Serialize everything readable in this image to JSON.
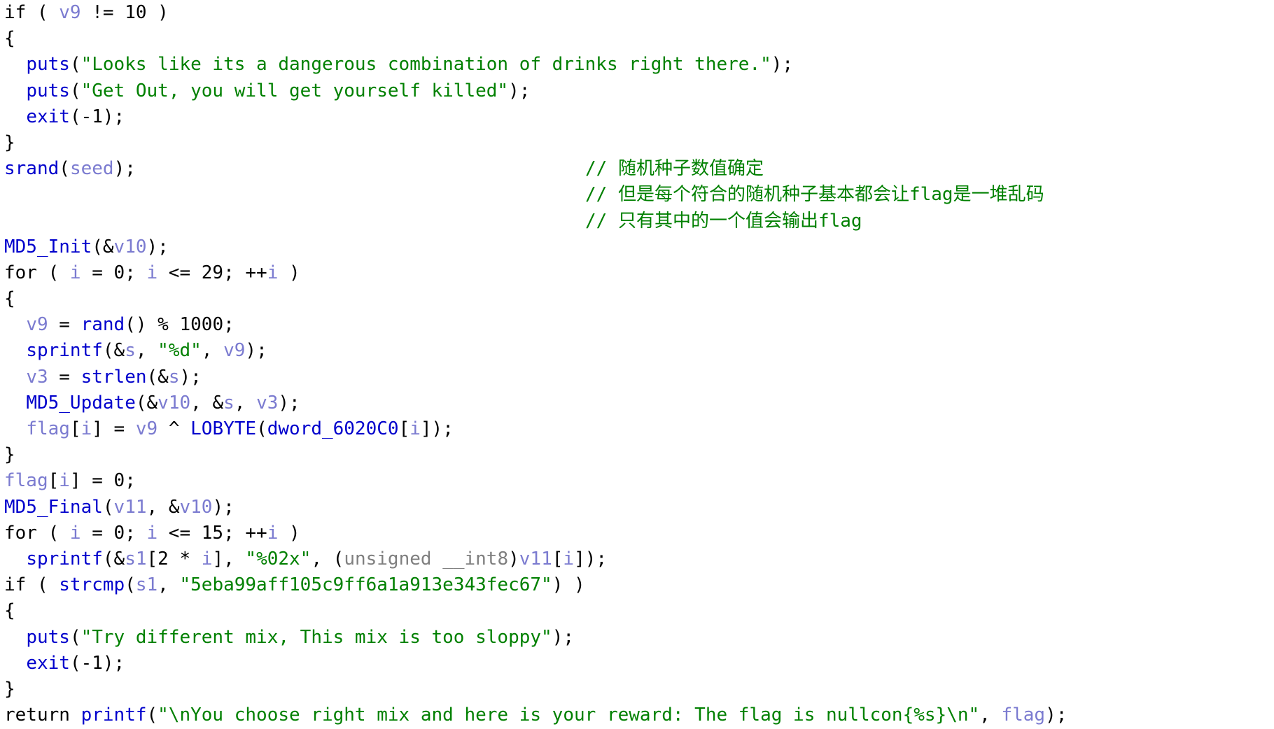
{
  "code": {
    "lines": [
      [
        [
          "kw",
          "if ( "
        ],
        [
          "var",
          "v9"
        ],
        [
          "punc",
          " != 10 )"
        ]
      ],
      [
        [
          "punc",
          "{"
        ]
      ],
      [
        [
          "punc",
          "  "
        ],
        [
          "fn",
          "puts"
        ],
        [
          "punc",
          "("
        ],
        [
          "str",
          "\"Looks like its a dangerous combination of drinks right there.\""
        ],
        [
          "punc",
          ");"
        ]
      ],
      [
        [
          "punc",
          "  "
        ],
        [
          "fn",
          "puts"
        ],
        [
          "punc",
          "("
        ],
        [
          "str",
          "\"Get Out, you will get yourself killed\""
        ],
        [
          "punc",
          ");"
        ]
      ],
      [
        [
          "punc",
          "  "
        ],
        [
          "fn",
          "exit"
        ],
        [
          "punc",
          "(-1);"
        ]
      ],
      [
        [
          "punc",
          "}"
        ]
      ],
      [
        [
          "fn",
          "srand"
        ],
        [
          "punc",
          "("
        ],
        [
          "var",
          "seed"
        ],
        [
          "punc",
          ");"
        ]
      ],
      [],
      [],
      [
        [
          "fn",
          "MD5_Init"
        ],
        [
          "punc",
          "(&"
        ],
        [
          "var",
          "v10"
        ],
        [
          "punc",
          ");"
        ]
      ],
      [
        [
          "kw",
          "for ( "
        ],
        [
          "var",
          "i"
        ],
        [
          "punc",
          " = 0; "
        ],
        [
          "var",
          "i"
        ],
        [
          "punc",
          " <= 29; ++"
        ],
        [
          "var",
          "i"
        ],
        [
          "punc",
          " )"
        ]
      ],
      [
        [
          "punc",
          "{"
        ]
      ],
      [
        [
          "punc",
          "  "
        ],
        [
          "var",
          "v9"
        ],
        [
          "punc",
          " = "
        ],
        [
          "fn",
          "rand"
        ],
        [
          "punc",
          "() % 1000;"
        ]
      ],
      [
        [
          "punc",
          "  "
        ],
        [
          "fn",
          "sprintf"
        ],
        [
          "punc",
          "(&"
        ],
        [
          "var",
          "s"
        ],
        [
          "punc",
          ", "
        ],
        [
          "str",
          "\"%d\""
        ],
        [
          "punc",
          ", "
        ],
        [
          "var",
          "v9"
        ],
        [
          "punc",
          ");"
        ]
      ],
      [
        [
          "punc",
          "  "
        ],
        [
          "var",
          "v3"
        ],
        [
          "punc",
          " = "
        ],
        [
          "fn",
          "strlen"
        ],
        [
          "punc",
          "(&"
        ],
        [
          "var",
          "s"
        ],
        [
          "punc",
          ");"
        ]
      ],
      [
        [
          "punc",
          "  "
        ],
        [
          "fn",
          "MD5_Update"
        ],
        [
          "punc",
          "(&"
        ],
        [
          "var",
          "v10"
        ],
        [
          "punc",
          ", &"
        ],
        [
          "var",
          "s"
        ],
        [
          "punc",
          ", "
        ],
        [
          "var",
          "v3"
        ],
        [
          "punc",
          ");"
        ]
      ],
      [
        [
          "punc",
          "  "
        ],
        [
          "var",
          "flag"
        ],
        [
          "punc",
          "["
        ],
        [
          "var",
          "i"
        ],
        [
          "punc",
          "] = "
        ],
        [
          "var",
          "v9"
        ],
        [
          "punc",
          " ^ "
        ],
        [
          "fn",
          "LOBYTE"
        ],
        [
          "punc",
          "("
        ],
        [
          "fn",
          "dword_6020C0"
        ],
        [
          "punc",
          "["
        ],
        [
          "var",
          "i"
        ],
        [
          "punc",
          "]);"
        ]
      ],
      [
        [
          "punc",
          "}"
        ]
      ],
      [
        [
          "var",
          "flag"
        ],
        [
          "punc",
          "["
        ],
        [
          "var",
          "i"
        ],
        [
          "punc",
          "] = 0;"
        ]
      ],
      [
        [
          "fn",
          "MD5_Final"
        ],
        [
          "punc",
          "("
        ],
        [
          "var",
          "v11"
        ],
        [
          "punc",
          ", &"
        ],
        [
          "var",
          "v10"
        ],
        [
          "punc",
          ");"
        ]
      ],
      [
        [
          "kw",
          "for ( "
        ],
        [
          "var",
          "i"
        ],
        [
          "punc",
          " = 0; "
        ],
        [
          "var",
          "i"
        ],
        [
          "punc",
          " <= 15; ++"
        ],
        [
          "var",
          "i"
        ],
        [
          "punc",
          " )"
        ]
      ],
      [
        [
          "punc",
          "  "
        ],
        [
          "fn",
          "sprintf"
        ],
        [
          "punc",
          "(&"
        ],
        [
          "var",
          "s1"
        ],
        [
          "punc",
          "[2 * "
        ],
        [
          "var",
          "i"
        ],
        [
          "punc",
          "], "
        ],
        [
          "str",
          "\"%02x\""
        ],
        [
          "punc",
          ", ("
        ],
        [
          "type",
          "unsigned __int8"
        ],
        [
          "punc",
          ")"
        ],
        [
          "var",
          "v11"
        ],
        [
          "punc",
          "["
        ],
        [
          "var",
          "i"
        ],
        [
          "punc",
          "]);"
        ]
      ],
      [
        [
          "kw",
          "if ( "
        ],
        [
          "fn",
          "strcmp"
        ],
        [
          "punc",
          "("
        ],
        [
          "var",
          "s1"
        ],
        [
          "punc",
          ", "
        ],
        [
          "str",
          "\"5eba99aff105c9ff6a1a913e343fec67\""
        ],
        [
          "punc",
          ") )"
        ]
      ],
      [
        [
          "punc",
          "{"
        ]
      ],
      [
        [
          "punc",
          "  "
        ],
        [
          "fn",
          "puts"
        ],
        [
          "punc",
          "("
        ],
        [
          "str",
          "\"Try different mix, This mix is too sloppy\""
        ],
        [
          "punc",
          ");"
        ]
      ],
      [
        [
          "punc",
          "  "
        ],
        [
          "fn",
          "exit"
        ],
        [
          "punc",
          "(-1);"
        ]
      ],
      [
        [
          "punc",
          "}"
        ]
      ],
      [
        [
          "kw",
          "return "
        ],
        [
          "fn",
          "printf"
        ],
        [
          "punc",
          "("
        ],
        [
          "str",
          "\"\\nYou choose right mix and here is your reward: The flag is nullcon{%s}\\n\""
        ],
        [
          "punc",
          ", "
        ],
        [
          "var",
          "flag"
        ],
        [
          "punc",
          ");"
        ]
      ]
    ],
    "comments": [
      {
        "line": 6,
        "text": "// 随机种子数值确定"
      },
      {
        "line": 7,
        "text": "// 但是每个符合的随机种子基本都会让flag是一堆乱码"
      },
      {
        "line": 8,
        "text": "// 只有其中的一个值会输出flag"
      }
    ]
  }
}
